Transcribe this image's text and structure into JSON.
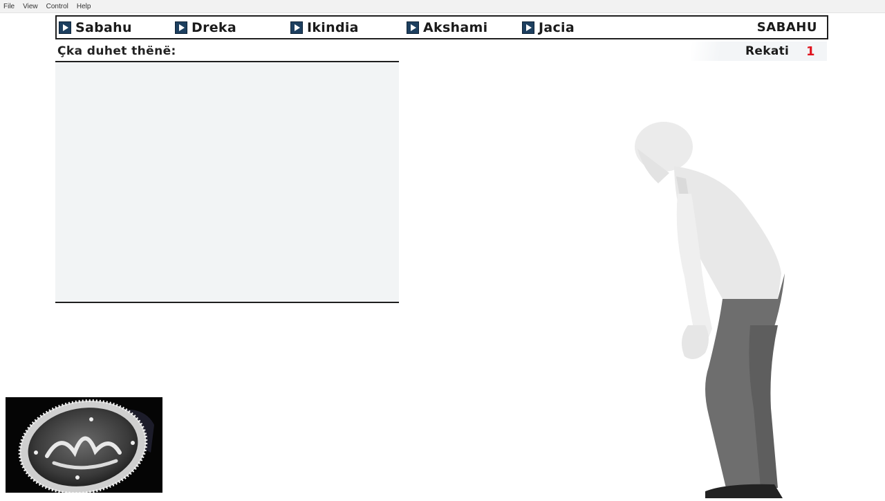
{
  "menubar": {
    "items": [
      {
        "label": "File"
      },
      {
        "label": "View"
      },
      {
        "label": "Control"
      },
      {
        "label": "Help"
      }
    ]
  },
  "nav": {
    "tabs": [
      {
        "label": "Sabahu"
      },
      {
        "label": "Dreka"
      },
      {
        "label": "Ikindia"
      },
      {
        "label": "Akshami"
      },
      {
        "label": "Jacia"
      }
    ],
    "current_prayer": "SABAHU"
  },
  "recitation": {
    "title": "Çka duhet thënë:",
    "text": ""
  },
  "rakat": {
    "label": "Rekati",
    "number": "1"
  },
  "colors": {
    "nav_icon": "#1d3f5f",
    "rakat_number": "#e0141e",
    "panel_bg": "#f2f4f5"
  }
}
